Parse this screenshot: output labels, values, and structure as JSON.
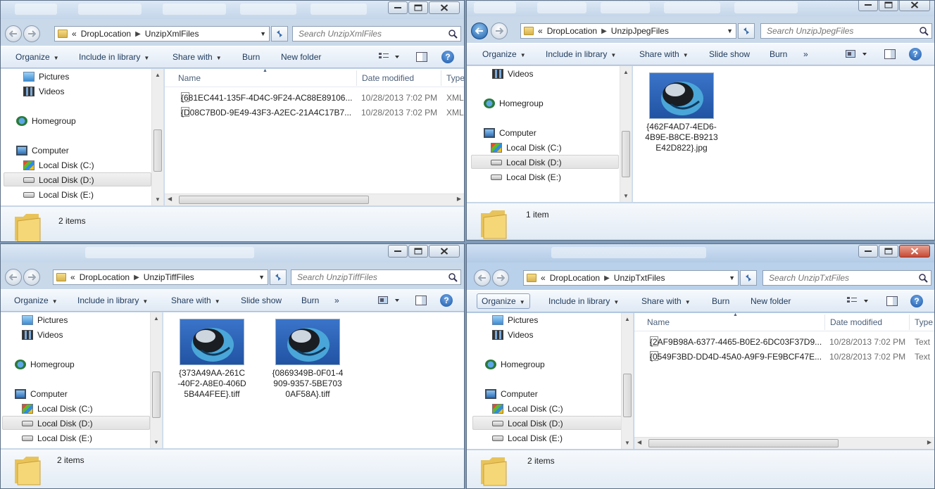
{
  "common": {
    "nav_items": {
      "pictures": "Pictures",
      "videos": "Videos",
      "homegroup": "Homegroup",
      "computer": "Computer",
      "disk_c": "Local Disk (C:)",
      "disk_d": "Local Disk (D:)",
      "disk_e": "Local Disk (E:)"
    },
    "commands": {
      "organize": "Organize",
      "include_in_library": "Include in library",
      "share_with": "Share with",
      "burn": "Burn",
      "new_folder": "New folder",
      "slide_show": "Slide show",
      "more": "»"
    },
    "columns": {
      "name": "Name",
      "date_modified": "Date modified",
      "type": "Type"
    },
    "crumb_overflow": "«",
    "crumb_root": "DropLocation",
    "help_glyph": "?"
  },
  "windows": {
    "xml": {
      "folder": "UnzipXmlFiles",
      "search_placeholder": "Search UnzipXmlFiles",
      "files": [
        {
          "name": "{681EC441-135F-4D4C-9F24-AC88E89106...",
          "date": "10/28/2013 7:02 PM",
          "type": "XML"
        },
        {
          "name": "{D08C7B0D-9E49-43F3-A2EC-21A4C17B7...",
          "date": "10/28/2013 7:02 PM",
          "type": "XML"
        }
      ],
      "item_count": "2 items"
    },
    "jpeg": {
      "folder": "UnzipJpegFiles",
      "search_placeholder": "Search UnzipJpegFiles",
      "thumbs": [
        {
          "label": "{462F4AD7-4ED6-\n4B9E-B8CE-B9213\nE42D822}.jpg"
        }
      ],
      "item_count": "1 item"
    },
    "tiff": {
      "folder": "UnzipTiffFiles",
      "search_placeholder": "Search UnzipTiffFiles",
      "thumbs": [
        {
          "label": "{373A49AA-261C\n-40F2-A8E0-406D\n5B4A4FEE}.tiff"
        },
        {
          "label": "{0869349B-0F01-4\n909-9357-5BE703\n0AF58A}.tiff"
        }
      ],
      "item_count": "2 items"
    },
    "txt": {
      "folder": "UnzipTxtFiles",
      "search_placeholder": "Search UnzipTxtFiles",
      "files": [
        {
          "name": "{2AF9B98A-6377-4465-B0E2-6DC03F37D9...",
          "date": "10/28/2013 7:02 PM",
          "type": "Text"
        },
        {
          "name": "{0549F3BD-DD4D-45A0-A9F9-FE9BCF47E...",
          "date": "10/28/2013 7:02 PM",
          "type": "Text"
        }
      ],
      "item_count": "2 items"
    }
  }
}
